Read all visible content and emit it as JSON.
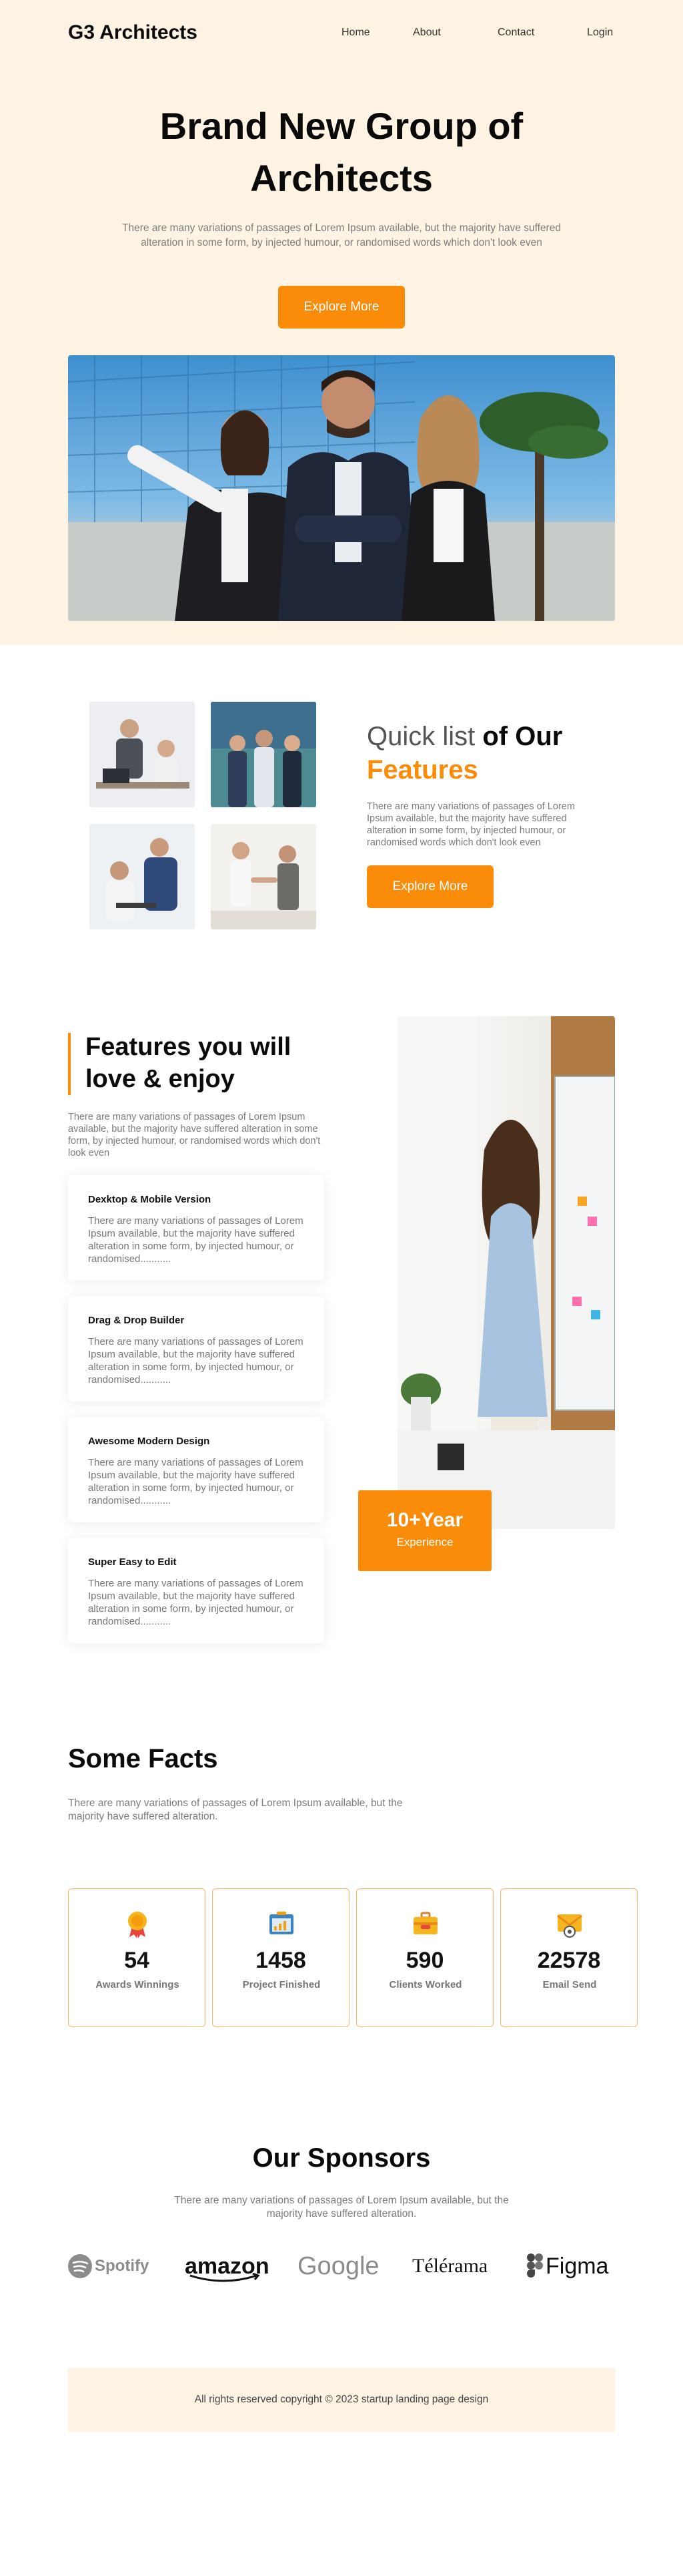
{
  "brand": "G3 Architects",
  "nav": {
    "home": "Home",
    "about": "About",
    "contact": "Contact",
    "login": "Login"
  },
  "hero": {
    "title": "Brand New Group of Architects",
    "subtitle": "There are many variations of passages of Lorem Ipsum available, but the majority have suffered alteration in some form, by injected humour, or randomised words which don't look even",
    "cta": "Explore More"
  },
  "quick_list": {
    "title_light": "Quick list ",
    "title_bold": "of Our",
    "title_accent": "Features",
    "text": "There are many variations of passages of Lorem Ipsum available, but the majority have suffered alteration in some form, by injected humour, or randomised words which don't look even",
    "cta": "Explore More"
  },
  "features": {
    "title": "Features you will love & enjoy",
    "text": "There are many variations of passages of Lorem Ipsum available, but the majority have suffered alteration in some form, by injected humour, or randomised words which don't look even",
    "cards": [
      {
        "title": "Dexktop & Mobile Version",
        "text": "There are many variations of passages of Lorem Ipsum available, but the majority have suffered alteration in some form, by injected humour, or randomised..........."
      },
      {
        "title": "Drag & Drop Builder",
        "text": "There are many variations of passages of Lorem Ipsum available, but the majority have suffered alteration in some form, by injected humour, or randomised..........."
      },
      {
        "title": "Awesome Modern Design",
        "text": "There are many variations of passages of Lorem Ipsum available, but the majority have suffered alteration in some form, by injected humour, or randomised..........."
      },
      {
        "title": "Super Easy to Edit",
        "text": "There are many variations of passages of Lorem Ipsum available, but the majority have suffered alteration in some form, by injected humour, or randomised..........."
      }
    ],
    "experience_value": "10+Year",
    "experience_label": "Experience"
  },
  "facts": {
    "title": "Some Facts",
    "text": "There are many variations of passages of Lorem Ipsum available, but the majority have suffered alteration.",
    "items": [
      {
        "icon": "award-ribbon-icon",
        "value": "54",
        "label": "Awards Winnings"
      },
      {
        "icon": "project-board-icon",
        "value": "1458",
        "label": "Project Finished"
      },
      {
        "icon": "clients-briefcase-icon",
        "value": "590",
        "label": "Clients Worked"
      },
      {
        "icon": "email-envelope-icon",
        "value": "22578",
        "label": "Email Send"
      }
    ]
  },
  "sponsors": {
    "title": "Our Sponsors",
    "text": "There are many variations of passages of Lorem Ipsum available, but the majority have suffered alteration.",
    "logos": [
      "Spotify",
      "amazon",
      "Google",
      "Télérama",
      "Figma"
    ]
  },
  "footer": "All rights reserved copyright © 2023 startup landing page design",
  "colors": {
    "accent": "#fb8c0a",
    "hero_bg": "#fff4e4",
    "card_border": "#f8b66a"
  }
}
